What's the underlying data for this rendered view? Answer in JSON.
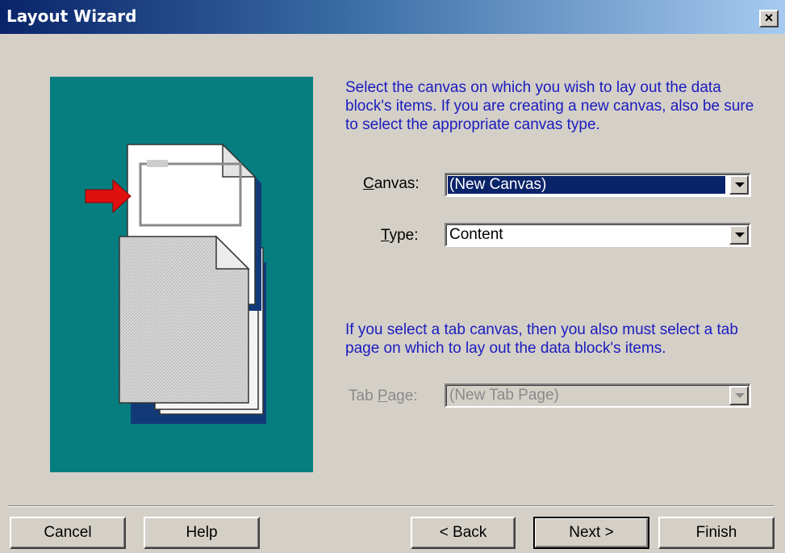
{
  "window": {
    "title": "Layout Wizard",
    "close_glyph": "×"
  },
  "instructions": {
    "primary": "Select the canvas on which you wish to lay out the data block's items. If you are creating a new canvas, also be sure to select the appropriate canvas type.",
    "tab": "If you select a tab canvas, then you also must select a tab page on which to lay out the data block's items."
  },
  "fields": {
    "canvas": {
      "label_mnemonic": "C",
      "label_rest": "anvas:",
      "value": "(New Canvas)"
    },
    "type": {
      "label_mnemonic": "T",
      "label_rest": "ype:",
      "value": "Content"
    },
    "tab_page": {
      "label_prefix": "Tab ",
      "label_mnemonic": "P",
      "label_rest": "age:",
      "value": "(New Tab Page)"
    }
  },
  "buttons": {
    "cancel": "Cancel",
    "help": "Help",
    "back": "< Back",
    "next": "Next >",
    "finish": "Finish"
  },
  "colors": {
    "illustration_bg": "#067e7f",
    "arrow": "#e01010",
    "instruction_text": "#1b1bbf",
    "selection": "#0a246a"
  }
}
